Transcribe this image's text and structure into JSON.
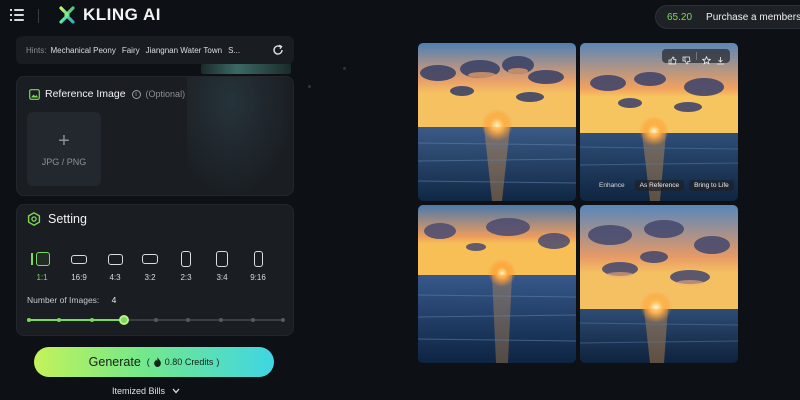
{
  "header": {
    "brand": "KLING AI",
    "credits": "65.20",
    "purchase_label": "Purchase a membership"
  },
  "hints": {
    "label": "Hints:",
    "items": [
      "Mechanical Peony",
      "Fairy",
      "Jiangnan Water Town",
      "S..."
    ]
  },
  "reference": {
    "title": "Reference Image",
    "info": "i",
    "optional": "(Optional)",
    "upload_plus": "+",
    "upload_label": "JPG / PNG"
  },
  "setting": {
    "title": "Setting",
    "ratios": [
      {
        "label": "1:1",
        "active": true
      },
      {
        "label": "16:9",
        "active": false
      },
      {
        "label": "4:3",
        "active": false
      },
      {
        "label": "3:2",
        "active": false
      },
      {
        "label": "2:3",
        "active": false
      },
      {
        "label": "3:4",
        "active": false
      },
      {
        "label": "9:16",
        "active": false
      }
    ],
    "num_images_label": "Number of Images:",
    "num_images_value": "4",
    "slider_selected_step": 4,
    "slider_steps": 9
  },
  "generate": {
    "label": "Generate",
    "credits_open": "(",
    "credits": "0.80 Credits",
    "credits_close": ")"
  },
  "bills": {
    "label": "Itemized Bills"
  },
  "images": {
    "tile2_actions": [
      "thumb-up-icon",
      "thumb-down-icon",
      "star-icon",
      "download-icon"
    ],
    "tile2_buttons": [
      "Enhance",
      "As Reference",
      "Bring to Life"
    ]
  },
  "colors": {
    "accent_green": "#7ed957",
    "panel": "#1a1e23",
    "background": "#0d1014"
  }
}
